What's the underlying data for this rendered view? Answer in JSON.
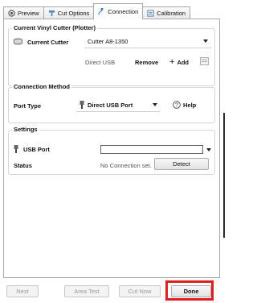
{
  "tabs": [
    {
      "label": "Preview",
      "icon": "preview-icon"
    },
    {
      "label": "Cut Options",
      "icon": "cut-options-icon"
    },
    {
      "label": "Connection",
      "icon": "connection-icon",
      "active": true
    },
    {
      "label": "Calibration",
      "icon": "calibration-icon"
    }
  ],
  "cutter_group": {
    "title": "Current Vinyl Cutter (Plotter)",
    "current_cutter_label": "Current Cutter",
    "current_cutter_value": "Cutter A8-1350",
    "connection_type": "Direct USB",
    "remove_label": "Remove",
    "add_label": "Add"
  },
  "connection_group": {
    "title": "Connection Method",
    "port_type_label": "Port Type",
    "port_type_value": "Direct USB Port",
    "help_label": "Help"
  },
  "settings_group": {
    "title": "Settings",
    "usb_port_label": "USB Port",
    "usb_port_value": "",
    "status_label": "Status",
    "status_value": "No Connection set.",
    "detect_label": "Detect"
  },
  "footer": {
    "next_label": "Next",
    "area_test_label": "Area Test",
    "cut_now_label": "Cut Now",
    "done_label": "Done"
  },
  "colors": {
    "highlight": "#e02020",
    "border": "#a9a9a9"
  }
}
